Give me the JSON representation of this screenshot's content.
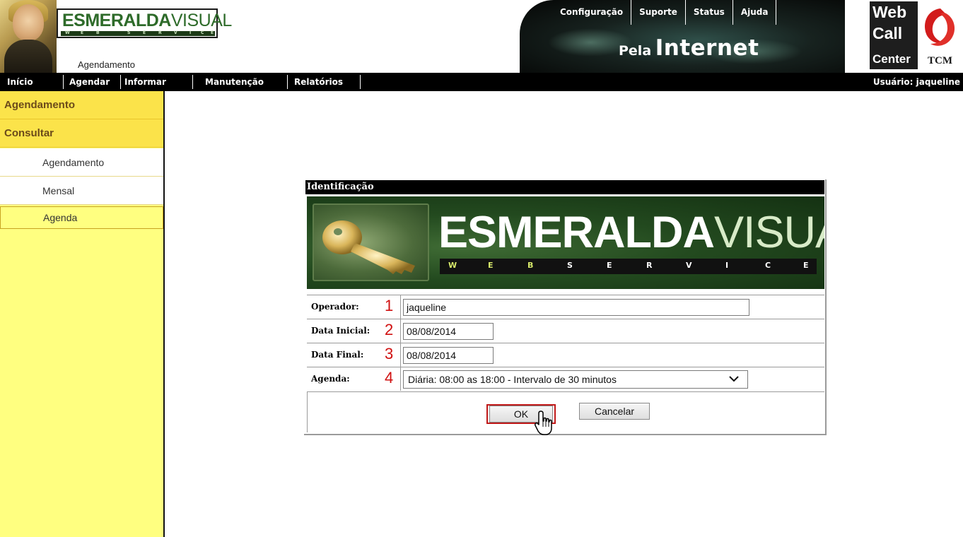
{
  "header": {
    "brand_bold": "ESMERALDA",
    "brand_light": "VISUAL",
    "brand_strip": [
      "W",
      "E",
      "B",
      "S",
      "E",
      "R",
      "V",
      "I",
      "C",
      "E"
    ],
    "module_label": "Agendamento",
    "top_links": [
      "Configuração",
      "Suporte",
      "Status",
      "Ajuda"
    ],
    "tagline_small": "Pela",
    "tagline_big": "Internet",
    "wcc": {
      "line1": "Web",
      "line2": "Call",
      "line3": "Center",
      "tcm": "TCM"
    }
  },
  "nav": {
    "items": [
      "Início",
      "Agendar",
      "Informar",
      "Manutenção",
      "Relatórios"
    ],
    "user": "Usuário: jaqueline"
  },
  "sidebar": {
    "head1": "Agendamento",
    "head2": "Consultar",
    "items": [
      {
        "label": "Agendamento",
        "active": false
      },
      {
        "label": "Mensal",
        "active": false
      },
      {
        "label": "Agenda",
        "active": true
      }
    ]
  },
  "dialog": {
    "title": "Identificação",
    "banner_bold": "ESMERALDA",
    "banner_light": "VISUAL",
    "banner_strip": [
      "W",
      "E",
      "B",
      "S",
      "E",
      "R",
      "V",
      "I",
      "C",
      "E"
    ],
    "fields": {
      "operador": {
        "label": "Operador:",
        "num": "1",
        "value": "jaqueline"
      },
      "data_inicial": {
        "label": "Data Inicial:",
        "num": "2",
        "value": "08/08/2014"
      },
      "data_final": {
        "label": "Data Final:",
        "num": "3",
        "value": "08/08/2014"
      },
      "agenda": {
        "label": "Agenda:",
        "num": "4",
        "value": "Diária: 08:00 as 18:00 - Intervalo de 30 minutos"
      }
    },
    "ok_label": "OK",
    "cancel_label": "Cancelar"
  },
  "colors": {
    "nav_bg": "#000000",
    "sidebar_bg": "#ffff80",
    "sidebar_head": "#fbe34a",
    "brand_green": "#2e6b2a",
    "annotation_red": "#d01010"
  }
}
